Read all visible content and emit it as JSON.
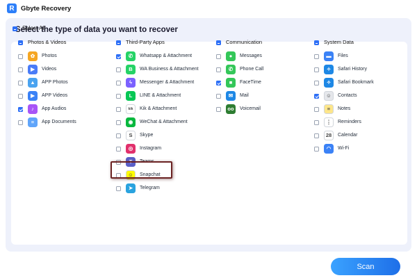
{
  "app": {
    "title": "Gbyte Recovery",
    "logo_letter": "R"
  },
  "main": {
    "heading": "Select the type of data you want to recover",
    "select_all_label": "Select All"
  },
  "columns": [
    {
      "header": "Photos & Videos",
      "header_state": "partial",
      "items": [
        {
          "label": "Photos",
          "checked": false,
          "icon": "photos-icon",
          "glyph": "✿",
          "color": "#f5a623"
        },
        {
          "label": "Videos",
          "checked": false,
          "icon": "videos-icon",
          "glyph": "▶",
          "color": "#4a7cf7"
        },
        {
          "label": "APP Photos",
          "checked": false,
          "icon": "app-photos-icon",
          "glyph": "▲",
          "color": "#4aa3f0"
        },
        {
          "label": "APP Videos",
          "checked": false,
          "icon": "app-videos-icon",
          "glyph": "▶",
          "color": "#3b82f6"
        },
        {
          "label": "App Audios",
          "checked": true,
          "icon": "app-audios-icon",
          "glyph": "♪",
          "color": "#a855f7"
        },
        {
          "label": "App Documents",
          "checked": false,
          "icon": "app-documents-icon",
          "glyph": "≡",
          "color": "#60a5fa"
        }
      ]
    },
    {
      "header": "Third-Party Apps",
      "header_state": "partial",
      "items": [
        {
          "label": "Whatsapp & Attachment",
          "checked": true,
          "icon": "whatsapp-icon",
          "glyph": "✆",
          "color": "#25d366"
        },
        {
          "label": "WA Business & Attachment",
          "checked": false,
          "icon": "wa-business-icon",
          "glyph": "B",
          "color": "#25d366"
        },
        {
          "label": "Messenger & Attachment",
          "checked": false,
          "icon": "messenger-icon",
          "glyph": "ϟ",
          "color": "#7b61ff"
        },
        {
          "label": "LINE & Attachment",
          "checked": false,
          "icon": "line-icon",
          "glyph": "L",
          "color": "#06c755"
        },
        {
          "label": "Kik & Attachment",
          "checked": false,
          "icon": "kik-icon",
          "glyph": "kik",
          "color": "#ffffff"
        },
        {
          "label": "WeChat & Attachment",
          "checked": false,
          "icon": "wechat-icon",
          "glyph": "◉",
          "color": "#09b83e"
        },
        {
          "label": "Skype",
          "checked": false,
          "icon": "skype-icon",
          "glyph": "S",
          "color": "#ffffff"
        },
        {
          "label": "Instagram",
          "checked": false,
          "icon": "instagram-icon",
          "glyph": "◎",
          "color": "#e1306c"
        },
        {
          "label": "Teams",
          "checked": false,
          "icon": "teams-icon",
          "glyph": "T",
          "color": "#5b5fc7"
        },
        {
          "label": "Snapchat",
          "checked": false,
          "icon": "snapchat-icon",
          "glyph": "☺",
          "color": "#fffc00"
        },
        {
          "label": "Telegram",
          "checked": false,
          "icon": "telegram-icon",
          "glyph": "➤",
          "color": "#2aa3df"
        }
      ]
    },
    {
      "header": "Communication",
      "header_state": "partial",
      "items": [
        {
          "label": "Messages",
          "checked": false,
          "icon": "messages-icon",
          "glyph": "●",
          "color": "#34c759"
        },
        {
          "label": "Phone Call",
          "checked": false,
          "icon": "phone-call-icon",
          "glyph": "✆",
          "color": "#34c759"
        },
        {
          "label": "FaceTime",
          "checked": true,
          "icon": "facetime-icon",
          "glyph": "■",
          "color": "#34c759"
        },
        {
          "label": "Mail",
          "checked": false,
          "icon": "mail-icon",
          "glyph": "✉",
          "color": "#1e88e5"
        },
        {
          "label": "Voicemail",
          "checked": false,
          "icon": "voicemail-icon",
          "glyph": "oo",
          "color": "#2e7d32"
        }
      ]
    },
    {
      "header": "System Data",
      "header_state": "partial",
      "items": [
        {
          "label": "Files",
          "checked": false,
          "icon": "files-icon",
          "glyph": "▬",
          "color": "#3b82f6"
        },
        {
          "label": "Safari History",
          "checked": false,
          "icon": "safari-history-icon",
          "glyph": "✧",
          "color": "#1e88e5"
        },
        {
          "label": "Safari Bookmark",
          "checked": false,
          "icon": "safari-bookmark-icon",
          "glyph": "✧",
          "color": "#1e88e5"
        },
        {
          "label": "Contacts",
          "checked": true,
          "icon": "contacts-icon",
          "glyph": "☺",
          "color": "#e5e7eb"
        },
        {
          "label": "Notes",
          "checked": false,
          "icon": "notes-icon",
          "glyph": "≡",
          "color": "#fde68a"
        },
        {
          "label": "Reminders",
          "checked": false,
          "icon": "reminders-icon",
          "glyph": "⋮",
          "color": "#ffffff"
        },
        {
          "label": "Calendar",
          "checked": false,
          "icon": "calendar-icon",
          "glyph": "28",
          "color": "#ffffff"
        },
        {
          "label": "Wi-Fi",
          "checked": false,
          "icon": "wifi-icon",
          "glyph": "◠",
          "color": "#3b82f6"
        }
      ]
    }
  ],
  "highlighted_item": "Instagram",
  "footer": {
    "scan_label": "Scan"
  }
}
